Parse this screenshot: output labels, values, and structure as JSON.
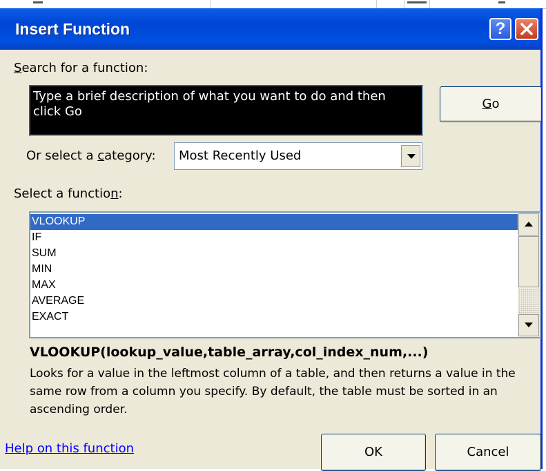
{
  "dialog": {
    "title": "Insert Function",
    "help_button": "?",
    "search_label_pre": "",
    "search_label_ak": "S",
    "search_label_post": "earch for a function:",
    "search_value": "Type a brief description of what you want to do and then click Go",
    "go_pre": "",
    "go_ak": "G",
    "go_post": "o",
    "category_label_pre": "Or select a ",
    "category_label_ak": "c",
    "category_label_post": "ategory:",
    "category_value": "Most Recently Used",
    "function_label_pre": "Select a functio",
    "function_label_ak": "n",
    "function_label_post": ":",
    "functions": [
      "VLOOKUP",
      "IF",
      "SUM",
      "MIN",
      "MAX",
      "AVERAGE",
      "EXACT"
    ],
    "selected_function": "VLOOKUP",
    "signature": "VLOOKUP(lookup_value,table_array,col_index_num,...)",
    "description": "Looks for a value in the leftmost column of a table, and then returns a value in the same row from a column you specify. By default, the table must be sorted in an ascending order.",
    "help_link": "Help on this function",
    "ok_label": "OK",
    "cancel_label": "Cancel"
  },
  "colors": {
    "titlebar": "#0046d5",
    "selection": "#316ac5",
    "dialog_bg": "#ece9d8",
    "search_bg": "#000000"
  },
  "icons": {
    "close": "close-icon",
    "dropdown": "chevron-down-icon",
    "scroll_up": "arrow-up-icon",
    "scroll_down": "arrow-down-icon"
  }
}
